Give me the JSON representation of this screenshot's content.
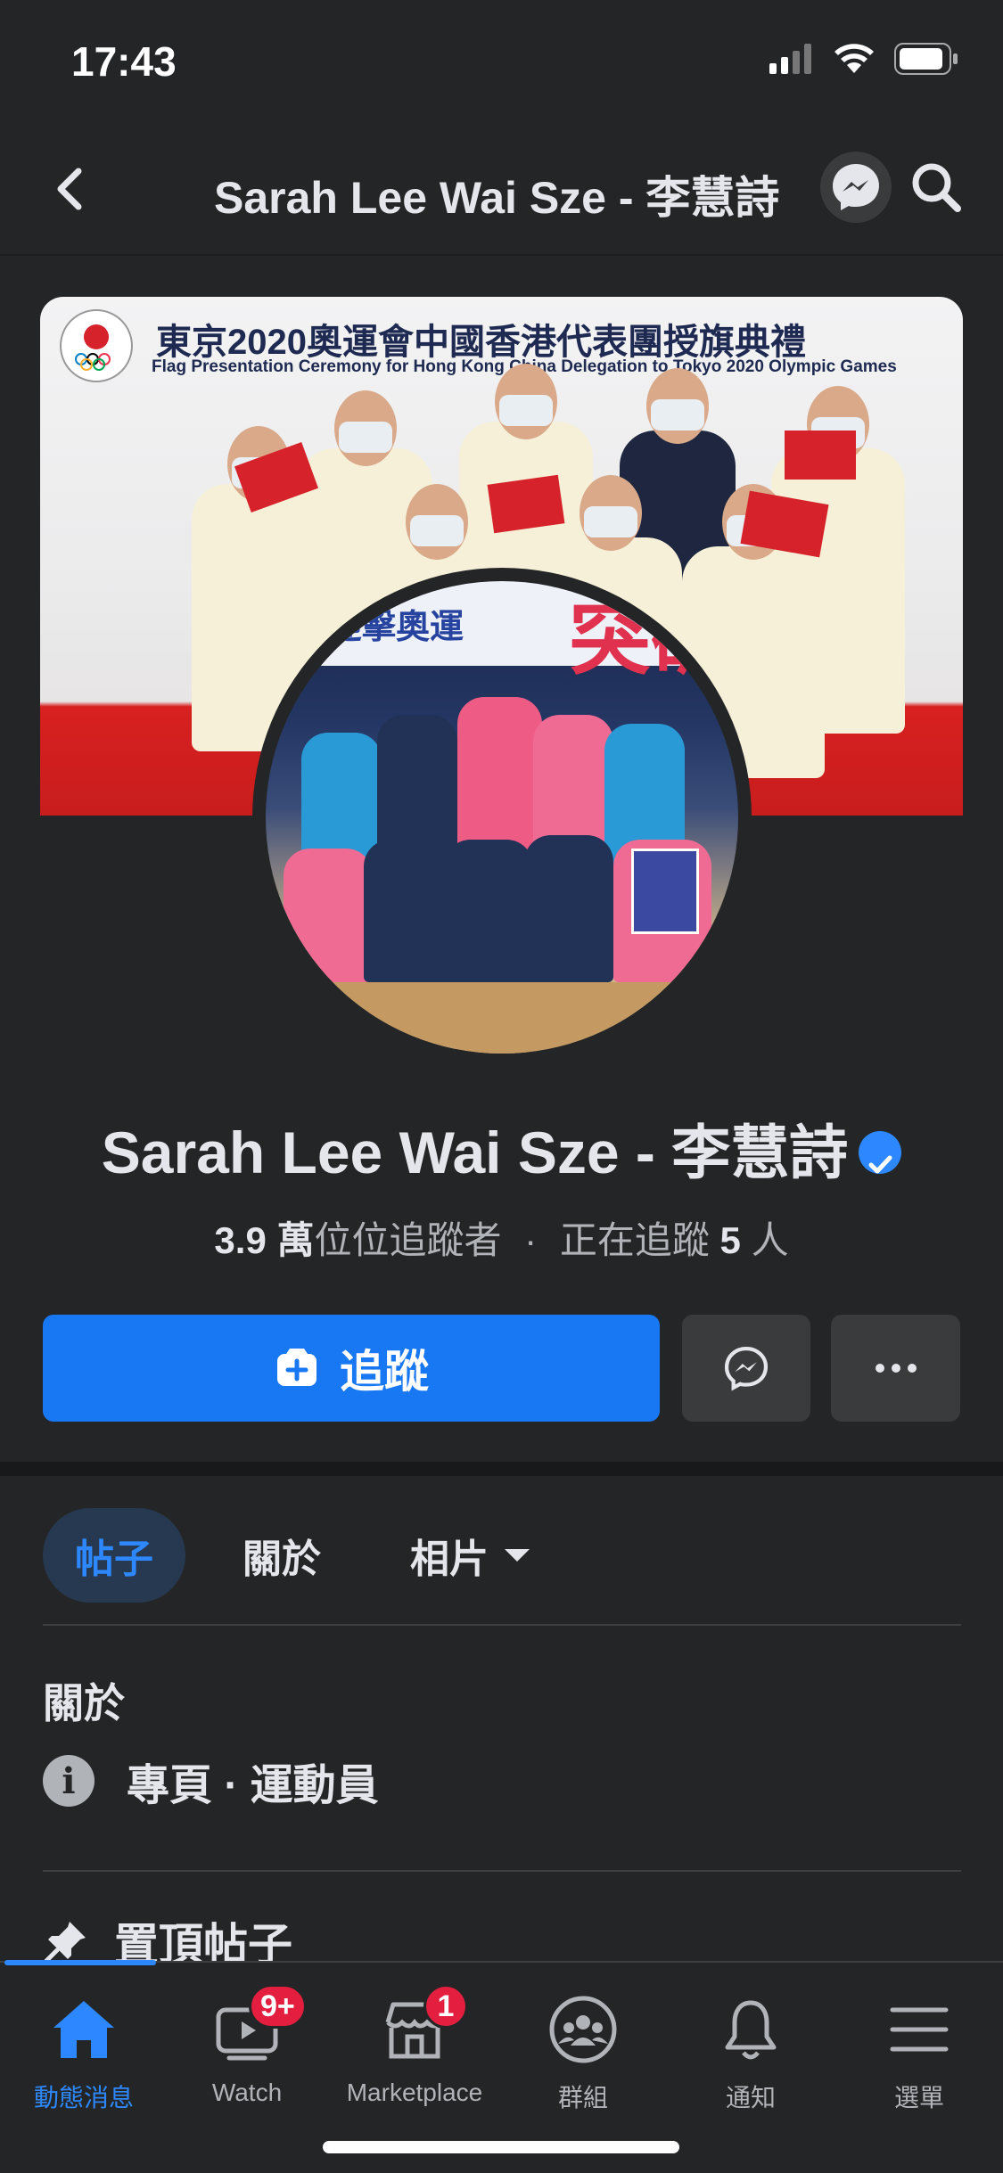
{
  "status": {
    "time": "17:43"
  },
  "nav": {
    "title": "Sarah Lee Wai Sze - 李慧詩"
  },
  "cover": {
    "title_zh": "東京2020奧運會中國香港代表團授旗典禮",
    "title_en": "Flag Presentation Ceremony for Hong Kong China Delegation to Tokyo 2020 Olympic Games"
  },
  "avatar": {
    "banner_text": "迎擊奧運",
    "banner_big": "突破"
  },
  "profile": {
    "name": "Sarah Lee Wai Sze - 李慧詩",
    "followers_count": "3.9 萬",
    "followers_label": "位位追蹤者",
    "separator": "·",
    "following_label": "正在追蹤",
    "following_count": "5",
    "following_unit": "人"
  },
  "actions": {
    "follow_label": "追蹤"
  },
  "tabs": [
    {
      "label": "帖子",
      "active": true
    },
    {
      "label": "關於",
      "active": false
    },
    {
      "label": "相片",
      "active": false
    }
  ],
  "about": {
    "heading": "關於",
    "category": "專頁 · 運動員"
  },
  "pinned": {
    "label": "置頂帖子"
  },
  "tabbar": [
    {
      "label": "動態消息",
      "icon": "home-icon",
      "badge": ""
    },
    {
      "label": "Watch",
      "icon": "watch-icon",
      "badge": "9+"
    },
    {
      "label": "Marketplace",
      "icon": "marketplace-icon",
      "badge": "1"
    },
    {
      "label": "群組",
      "icon": "groups-icon",
      "badge": ""
    },
    {
      "label": "通知",
      "icon": "bell-icon",
      "badge": ""
    },
    {
      "label": "選單",
      "icon": "menu-icon",
      "badge": ""
    }
  ],
  "colors": {
    "accent": "#2d88ff",
    "button_blue": "#1877f2",
    "background": "#242526",
    "badge_red": "#e41e3f"
  }
}
